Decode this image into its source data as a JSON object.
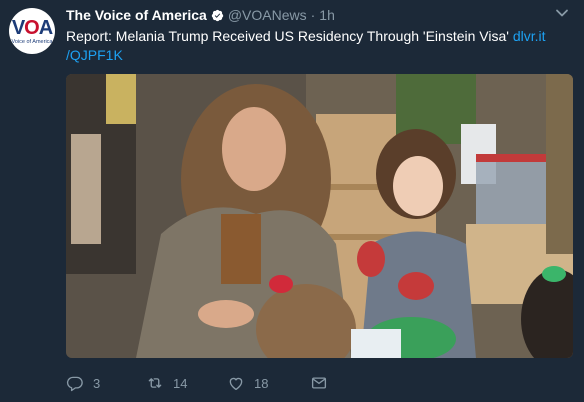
{
  "tweet": {
    "author_name": "The Voice of America",
    "handle": "@VOANews",
    "separator": "·",
    "time": "1h",
    "text": "Report: Melania Trump Received US Residency Through 'Einstein Visa'",
    "link_part1": "dlvr.it",
    "link_part2": "/QJPF1K"
  },
  "avatar": {
    "logo_v": "V",
    "logo_o": "O",
    "logo_a": "A",
    "logo_sub": "Voice of America"
  },
  "actions": {
    "replies": "3",
    "retweets": "14",
    "likes": "18"
  },
  "icons": [
    "verified-badge-icon",
    "chevron-down-icon",
    "reply-icon",
    "retweet-icon",
    "like-icon",
    "direct-message-icon"
  ],
  "colors": {
    "background": "#1c2938",
    "link": "#1da1f2",
    "secondary_text": "#8899a6",
    "verified": "#1da1f2"
  }
}
